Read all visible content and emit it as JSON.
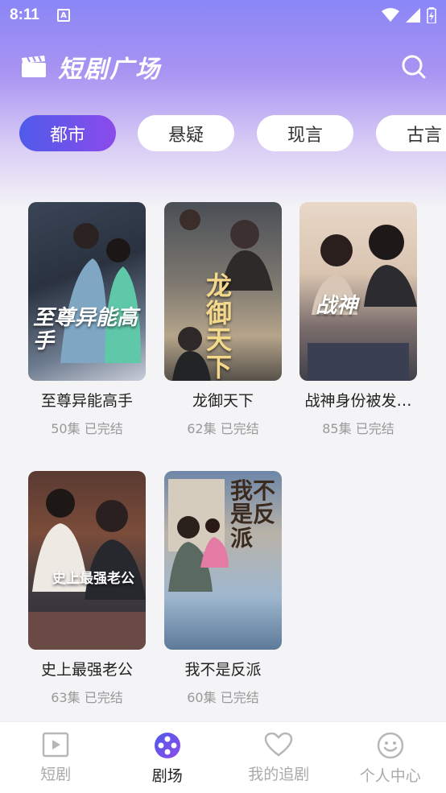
{
  "status_bar": {
    "time": "8:11",
    "notification_glyph": "A"
  },
  "header": {
    "title": "短剧广场"
  },
  "categories": [
    {
      "label": "都市",
      "active": true
    },
    {
      "label": "悬疑",
      "active": false
    },
    {
      "label": "现言",
      "active": false
    },
    {
      "label": "古言",
      "active": false
    }
  ],
  "dramas": [
    {
      "title": "至尊异能高手",
      "episodes": "50集",
      "status": "已完结",
      "poster_text": "至尊异能高手"
    },
    {
      "title": "龙御天下",
      "episodes": "62集",
      "status": "已完结",
      "poster_text": "龙御天下"
    },
    {
      "title": "战神身份被发…",
      "episodes": "85集",
      "status": "已完结",
      "poster_text": "战神"
    },
    {
      "title": "史上最强老公",
      "episodes": "63集",
      "status": "已完结",
      "poster_text": "史上最强老公"
    },
    {
      "title": "我不是反派",
      "episodes": "60集",
      "status": "已完结",
      "poster_text": "我不是反派"
    }
  ],
  "bottom_nav": [
    {
      "label": "短剧",
      "icon": "play-icon",
      "active": false
    },
    {
      "label": "剧场",
      "icon": "theater-icon",
      "active": true
    },
    {
      "label": "我的追剧",
      "icon": "heart-icon",
      "active": false
    },
    {
      "label": "个人中心",
      "icon": "smile-icon",
      "active": false
    }
  ],
  "colors": {
    "accent_start": "#4f5bea",
    "accent_end": "#8b4bea",
    "meta_gray": "#999999"
  }
}
